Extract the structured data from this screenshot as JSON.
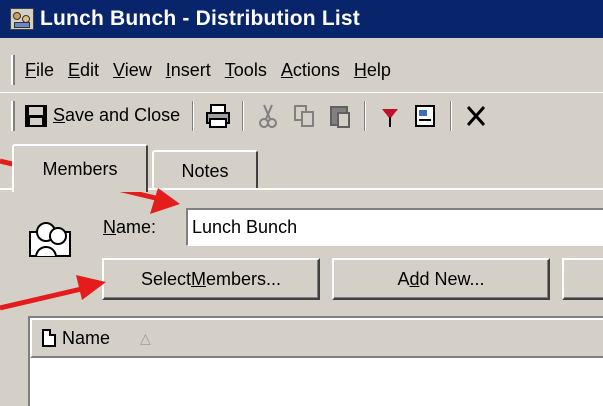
{
  "window": {
    "title": "Lunch Bunch - Distribution List"
  },
  "menu": {
    "items": [
      {
        "accel": "F",
        "rest": "ile"
      },
      {
        "accel": "E",
        "rest": "dit"
      },
      {
        "accel": "V",
        "rest": "iew"
      },
      {
        "accel": "I",
        "rest": "nsert"
      },
      {
        "accel": "T",
        "rest": "ools"
      },
      {
        "accel": "A",
        "rest": "ctions"
      },
      {
        "accel": "H",
        "rest": "elp"
      }
    ]
  },
  "toolbar": {
    "save_accel": "S",
    "save_rest": "ave and Close",
    "icons": [
      "print-icon",
      "cut-icon",
      "copy-icon",
      "paste-icon",
      "flag-icon",
      "address-book-icon",
      "delete-icon"
    ]
  },
  "tabs": {
    "members": "Members",
    "notes": "Notes"
  },
  "form": {
    "name_label_accel": "N",
    "name_label_rest": "ame:",
    "name_value": "Lunch Bunch"
  },
  "buttons": {
    "select_pre": "Select ",
    "select_accel": "M",
    "select_post": "embers...",
    "add_pre": "A",
    "add_accel": "d",
    "add_post": "d New..."
  },
  "list": {
    "column_name": "Name",
    "sort_glyph": "△"
  },
  "colors": {
    "titlebar": "#08246b",
    "face": "#d4d0c8",
    "arrow": "#e51c1c"
  }
}
